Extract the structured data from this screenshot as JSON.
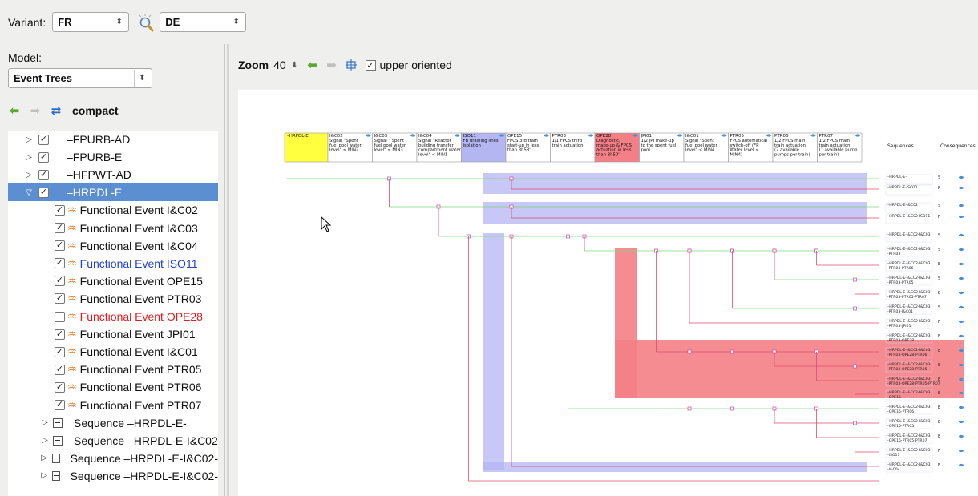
{
  "topbar": {
    "variant_label": "Variant:",
    "variant_a": "FR",
    "variant_b": "DE",
    "compare_icon": "magnifier-icon"
  },
  "left": {
    "model_label": "Model:",
    "model_value": "Event Trees",
    "compact_label": "compact",
    "tree": [
      {
        "text": "–FPURB-AD",
        "kind": "tree",
        "checked": true
      },
      {
        "text": "–FPURB-E",
        "kind": "tree",
        "checked": true
      },
      {
        "text": "–HFPWT-AD",
        "kind": "tree",
        "checked": true
      },
      {
        "text": "–HRPDL-E",
        "kind": "tree",
        "checked": true,
        "selected": true
      },
      {
        "text": "Functional Event I&C02",
        "kind": "fe",
        "checked": true
      },
      {
        "text": "Functional Event I&C03",
        "kind": "fe",
        "checked": true
      },
      {
        "text": "Functional Event I&C04",
        "kind": "fe",
        "checked": true
      },
      {
        "text": "Functional Event ISO11",
        "kind": "fe",
        "checked": true,
        "color": "blue"
      },
      {
        "text": "Functional Event OPE15",
        "kind": "fe",
        "checked": true
      },
      {
        "text": "Functional Event PTR03",
        "kind": "fe",
        "checked": true
      },
      {
        "text": "Functional Event OPE28",
        "kind": "fe",
        "checked": false,
        "color": "red"
      },
      {
        "text": "Functional Event JPI01",
        "kind": "fe",
        "checked": true
      },
      {
        "text": "Functional Event I&C01",
        "kind": "fe",
        "checked": true
      },
      {
        "text": "Functional Event PTR05",
        "kind": "fe",
        "checked": true
      },
      {
        "text": "Functional Event PTR06",
        "kind": "fe",
        "checked": true
      },
      {
        "text": "Functional Event PTR07",
        "kind": "fe",
        "checked": true
      },
      {
        "text": "Sequence –HRPDL-E-",
        "kind": "seq"
      },
      {
        "text": "Sequence –HRPDL-E-I&C02",
        "kind": "seq"
      },
      {
        "text": "Sequence –HRPDL-E-I&C02-",
        "kind": "seq"
      },
      {
        "text": "Sequence –HRPDL-E-I&C02-",
        "kind": "seq"
      }
    ]
  },
  "right": {
    "zoom_label": "Zoom",
    "zoom_value": "40",
    "upper_label": "upper oriented",
    "upper_checked": true
  },
  "event_tree": {
    "initiator": "–HRPDL-E",
    "headers": [
      {
        "id": "I&C02",
        "desc": "Signal \"Spent fuel pool water level\" < MIN2",
        "style": "normal"
      },
      {
        "id": "I&C03",
        "desc": "Signal \" Spent fuel pool water level\" < MIN3",
        "style": "normal"
      },
      {
        "id": "I&C04",
        "desc": "Signal \"Reactor building transfer compartment water level\" < MIN1",
        "style": "normal"
      },
      {
        "id": "ISO11",
        "desc": "FB draining lines isolation",
        "style": "blue"
      },
      {
        "id": "OPE15",
        "desc": "FPCS 3rd train start-up in less than 3h58'",
        "style": "normal"
      },
      {
        "id": "PTR03",
        "desc": "1/1 FPCS third train actuation",
        "style": "normal"
      },
      {
        "id": "OPE28",
        "desc": "Diagnostic, make-up & FPCS actuation in less than 3h50'",
        "style": "red"
      },
      {
        "id": "JPI01",
        "desc": "1/2 JPI make-up to the spent fuel pool",
        "style": "normal"
      },
      {
        "id": "I&C01",
        "desc": "Signal \"Spent fuel pool water level\" < MIN4",
        "style": "normal"
      },
      {
        "id": "PTR05",
        "desc": "FPCS automatical switch-off (FP Water level < MIN4)",
        "style": "normal"
      },
      {
        "id": "PTR06",
        "desc": "1/2 FPCS main train actuation (2 available pumps per train)",
        "style": "normal"
      },
      {
        "id": "PTR07",
        "desc": "1/2 FPCS main train actuation (1 available pump per train)",
        "style": "normal"
      }
    ],
    "sequences_label": "Sequences",
    "consequences_label": "Consequences",
    "rows": [
      {
        "name": "–HRPDL-E-",
        "cons": "S"
      },
      {
        "name": "–HRPDL-E-ISO11",
        "cons": "F"
      },
      {
        "name": "–HRPDL-E-I&C02",
        "cons": "S"
      },
      {
        "name": "–HRPDL-E-I&C02-ISO11",
        "cons": "F"
      },
      {
        "name": "–HRPDL-E-I&C02-I&C03",
        "cons": "S"
      },
      {
        "name": "–HRPDL-E-I&C02-I&C03 -PTR03",
        "cons": "S"
      },
      {
        "name": "–HRPDL-E-I&C02-I&C03 -PTR03-PTR06",
        "cons": "E"
      },
      {
        "name": "–HRPDL-E-I&C02-I&C03 -PTR03-PTR05",
        "cons": "S"
      },
      {
        "name": "–HRPDL-E-I&C02-I&C03 -PTR03-PTR05-PTR07",
        "cons": "E"
      },
      {
        "name": "–HRPDL-E-I&C02-I&C03 -PTR03-I&C01",
        "cons": "S"
      },
      {
        "name": "–HRPDL-E-I&C02-I&C03 -PTR03-JPI01",
        "cons": "F"
      },
      {
        "name": "–HRPDL-E-I&C02-I&C03 -PTR03-OPE28",
        "cons": "E"
      },
      {
        "name": "–HRPDL-E-I&C02-I&C03 -PTR03-OPE28-PTR06",
        "cons": "E"
      },
      {
        "name": "–HRPDL-E-I&C02-I&C03 -PTR03-OPE28-PTR05",
        "cons": "E"
      },
      {
        "name": "–HRPDL-E-I&C02-I&C03 -PTR03-OPE28-PTR05-PTR07",
        "cons": "E"
      },
      {
        "name": "–HRPDL-E-I&C02-I&C03 -OPE15",
        "cons": "E"
      },
      {
        "name": "–HRPDL-E-I&C02-I&C03 -OPE15-PTR06",
        "cons": "E"
      },
      {
        "name": "–HRPDL-E-I&C02-I&C03 -OPE15-PTR05",
        "cons": "E"
      },
      {
        "name": "–HRPDL-E-I&C02-I&C03 -OPE15-PTR05-PTR07",
        "cons": "E"
      },
      {
        "name": "–HRPDL-E-I&C02-I&C03 -ISO11",
        "cons": "F"
      },
      {
        "name": "–HRPDL-E-I&C02-I&C03 -I&C04",
        "cons": "F"
      }
    ]
  },
  "colors": {
    "selection": "#5c8ed2",
    "success_line": "#7ad67a",
    "failure_line": "#e04a6e",
    "iso_band": "#b4b6f2",
    "ope_band": "#f47f86",
    "initiator_fill": "#ffff40"
  }
}
